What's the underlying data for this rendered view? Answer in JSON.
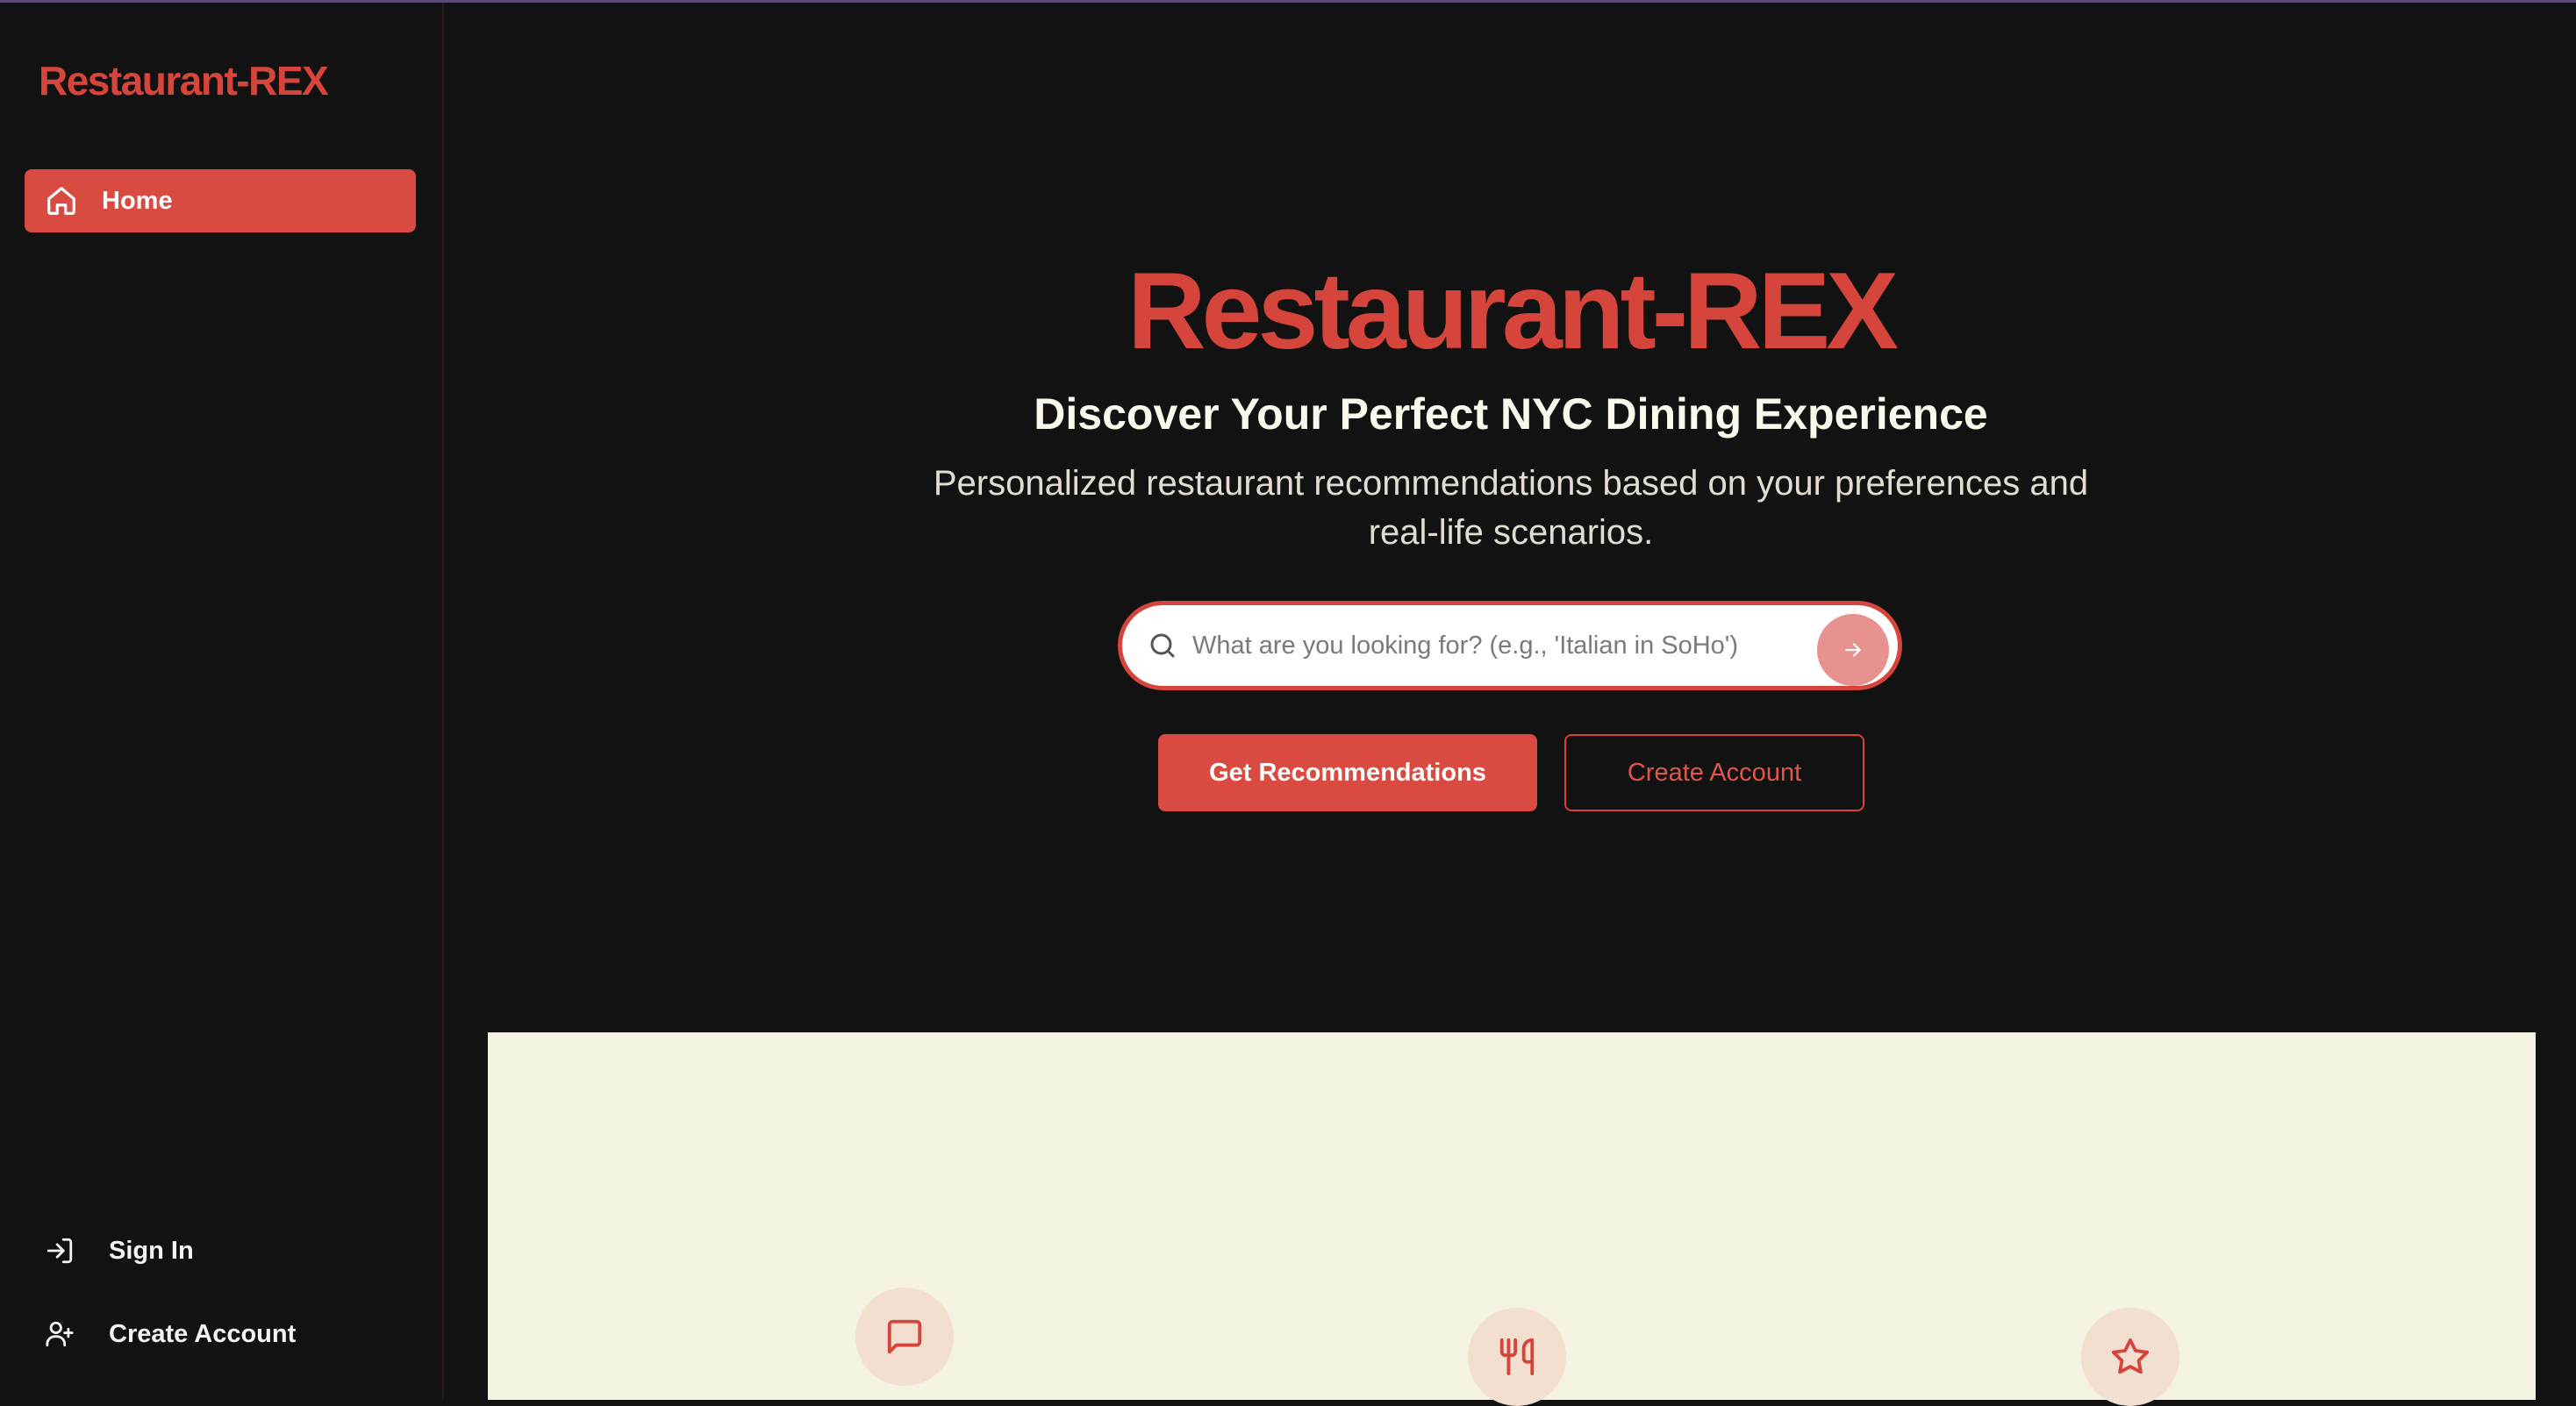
{
  "app": {
    "brand": "Restaurant-REX",
    "accent_color": "#d6453b",
    "background_color": "#121212",
    "feature_panel_color": "#f4f3e1"
  },
  "sidebar": {
    "brand": "Restaurant-REX",
    "nav": [
      {
        "label": "Home",
        "icon": "home-icon",
        "active": true
      }
    ],
    "bottom": [
      {
        "label": "Sign In",
        "icon": "sign-in-icon"
      },
      {
        "label": "Create Account",
        "icon": "user-plus-icon"
      }
    ]
  },
  "hero": {
    "title": "Restaurant-REX",
    "subtitle": "Discover Your Perfect NYC Dining Experience",
    "description": "Personalized restaurant recommendations based on your preferences and real-life scenarios."
  },
  "search": {
    "placeholder": "What are you looking for? (e.g., 'Italian in SoHo')",
    "value": "",
    "icon": "search-icon",
    "submit_icon": "arrow-right-icon"
  },
  "actions": {
    "primary_label": "Get Recommendations",
    "secondary_label": "Create Account"
  },
  "features": {
    "icons": [
      "message-square-icon",
      "utensils-icon",
      "star-icon"
    ]
  }
}
